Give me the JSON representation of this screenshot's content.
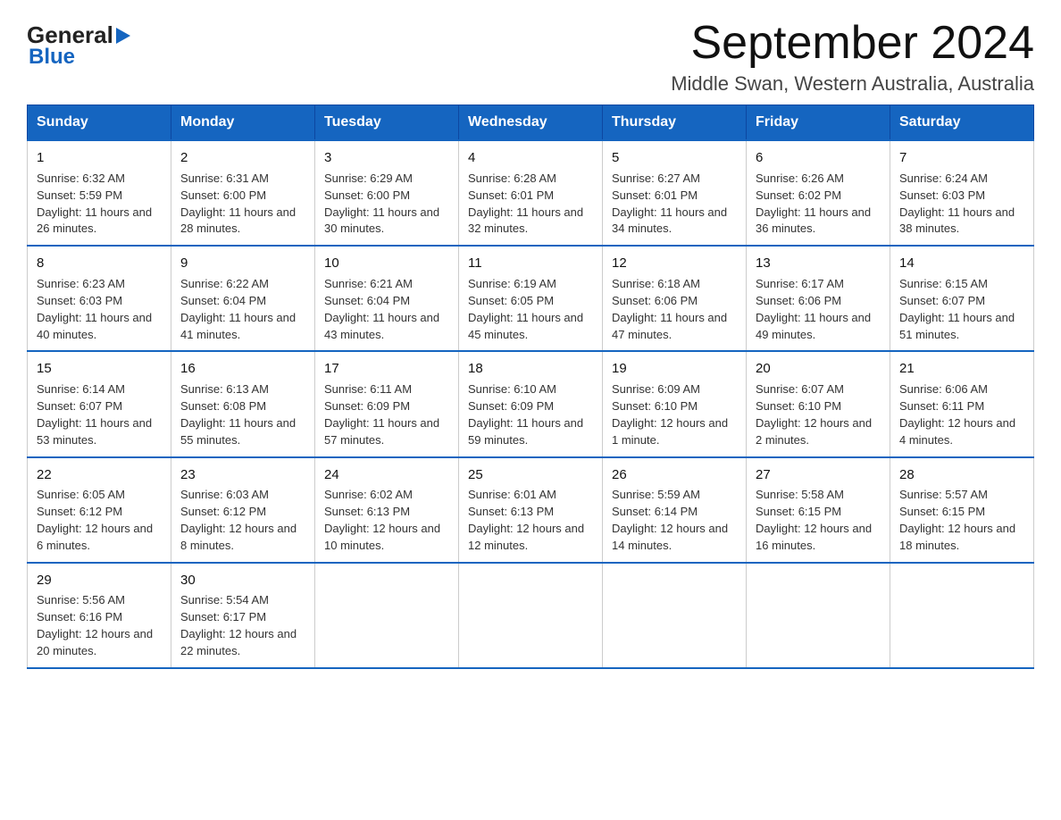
{
  "logo": {
    "general": "General",
    "blue": "Blue",
    "arrow_alt": "arrow-right"
  },
  "header": {
    "title": "September 2024",
    "subtitle": "Middle Swan, Western Australia, Australia"
  },
  "days_of_week": [
    "Sunday",
    "Monday",
    "Tuesday",
    "Wednesday",
    "Thursday",
    "Friday",
    "Saturday"
  ],
  "weeks": [
    [
      {
        "date": "1",
        "sunrise": "6:32 AM",
        "sunset": "5:59 PM",
        "daylight": "11 hours and 26 minutes."
      },
      {
        "date": "2",
        "sunrise": "6:31 AM",
        "sunset": "6:00 PM",
        "daylight": "11 hours and 28 minutes."
      },
      {
        "date": "3",
        "sunrise": "6:29 AM",
        "sunset": "6:00 PM",
        "daylight": "11 hours and 30 minutes."
      },
      {
        "date": "4",
        "sunrise": "6:28 AM",
        "sunset": "6:01 PM",
        "daylight": "11 hours and 32 minutes."
      },
      {
        "date": "5",
        "sunrise": "6:27 AM",
        "sunset": "6:01 PM",
        "daylight": "11 hours and 34 minutes."
      },
      {
        "date": "6",
        "sunrise": "6:26 AM",
        "sunset": "6:02 PM",
        "daylight": "11 hours and 36 minutes."
      },
      {
        "date": "7",
        "sunrise": "6:24 AM",
        "sunset": "6:03 PM",
        "daylight": "11 hours and 38 minutes."
      }
    ],
    [
      {
        "date": "8",
        "sunrise": "6:23 AM",
        "sunset": "6:03 PM",
        "daylight": "11 hours and 40 minutes."
      },
      {
        "date": "9",
        "sunrise": "6:22 AM",
        "sunset": "6:04 PM",
        "daylight": "11 hours and 41 minutes."
      },
      {
        "date": "10",
        "sunrise": "6:21 AM",
        "sunset": "6:04 PM",
        "daylight": "11 hours and 43 minutes."
      },
      {
        "date": "11",
        "sunrise": "6:19 AM",
        "sunset": "6:05 PM",
        "daylight": "11 hours and 45 minutes."
      },
      {
        "date": "12",
        "sunrise": "6:18 AM",
        "sunset": "6:06 PM",
        "daylight": "11 hours and 47 minutes."
      },
      {
        "date": "13",
        "sunrise": "6:17 AM",
        "sunset": "6:06 PM",
        "daylight": "11 hours and 49 minutes."
      },
      {
        "date": "14",
        "sunrise": "6:15 AM",
        "sunset": "6:07 PM",
        "daylight": "11 hours and 51 minutes."
      }
    ],
    [
      {
        "date": "15",
        "sunrise": "6:14 AM",
        "sunset": "6:07 PM",
        "daylight": "11 hours and 53 minutes."
      },
      {
        "date": "16",
        "sunrise": "6:13 AM",
        "sunset": "6:08 PM",
        "daylight": "11 hours and 55 minutes."
      },
      {
        "date": "17",
        "sunrise": "6:11 AM",
        "sunset": "6:09 PM",
        "daylight": "11 hours and 57 minutes."
      },
      {
        "date": "18",
        "sunrise": "6:10 AM",
        "sunset": "6:09 PM",
        "daylight": "11 hours and 59 minutes."
      },
      {
        "date": "19",
        "sunrise": "6:09 AM",
        "sunset": "6:10 PM",
        "daylight": "12 hours and 1 minute."
      },
      {
        "date": "20",
        "sunrise": "6:07 AM",
        "sunset": "6:10 PM",
        "daylight": "12 hours and 2 minutes."
      },
      {
        "date": "21",
        "sunrise": "6:06 AM",
        "sunset": "6:11 PM",
        "daylight": "12 hours and 4 minutes."
      }
    ],
    [
      {
        "date": "22",
        "sunrise": "6:05 AM",
        "sunset": "6:12 PM",
        "daylight": "12 hours and 6 minutes."
      },
      {
        "date": "23",
        "sunrise": "6:03 AM",
        "sunset": "6:12 PM",
        "daylight": "12 hours and 8 minutes."
      },
      {
        "date": "24",
        "sunrise": "6:02 AM",
        "sunset": "6:13 PM",
        "daylight": "12 hours and 10 minutes."
      },
      {
        "date": "25",
        "sunrise": "6:01 AM",
        "sunset": "6:13 PM",
        "daylight": "12 hours and 12 minutes."
      },
      {
        "date": "26",
        "sunrise": "5:59 AM",
        "sunset": "6:14 PM",
        "daylight": "12 hours and 14 minutes."
      },
      {
        "date": "27",
        "sunrise": "5:58 AM",
        "sunset": "6:15 PM",
        "daylight": "12 hours and 16 minutes."
      },
      {
        "date": "28",
        "sunrise": "5:57 AM",
        "sunset": "6:15 PM",
        "daylight": "12 hours and 18 minutes."
      }
    ],
    [
      {
        "date": "29",
        "sunrise": "5:56 AM",
        "sunset": "6:16 PM",
        "daylight": "12 hours and 20 minutes."
      },
      {
        "date": "30",
        "sunrise": "5:54 AM",
        "sunset": "6:17 PM",
        "daylight": "12 hours and 22 minutes."
      },
      null,
      null,
      null,
      null,
      null
    ]
  ],
  "labels": {
    "sunrise": "Sunrise:",
    "sunset": "Sunset:",
    "daylight": "Daylight:"
  }
}
